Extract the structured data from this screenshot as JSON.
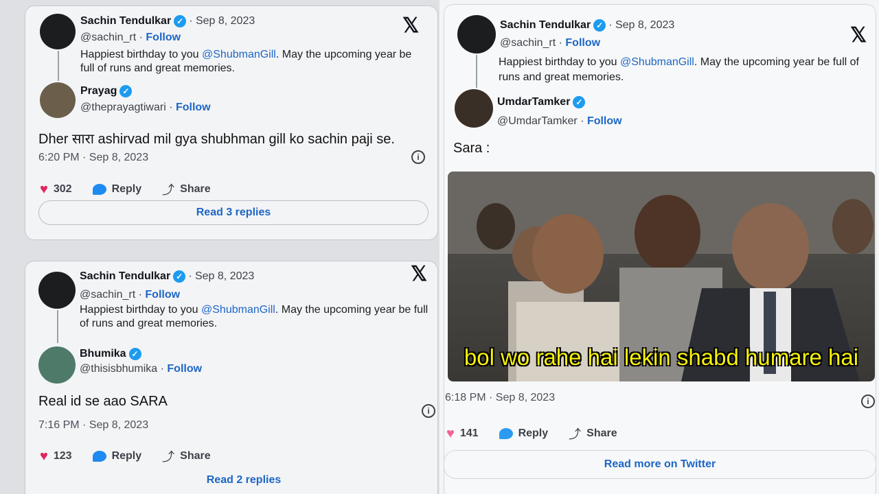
{
  "left": {
    "tweet1": {
      "parent": {
        "name": "Sachin Tendulkar",
        "date": "· Sep 8, 2023",
        "handle": "@sachin_rt ·",
        "follow": "Follow",
        "text_before": "Happiest birthday to you ",
        "mention": "@ShubmanGill",
        "text_after": ". May the upcoming year be full of runs and great memories."
      },
      "reply": {
        "name": "Prayag",
        "handle": "@theprayagtiwari ·",
        "follow": "Follow",
        "text": "Dher सारा ashirvad mil gya shubhman gill ko sachin paji se.",
        "timestamp": "6:20 PM · Sep 8, 2023",
        "likes": "302",
        "reply_label": "Reply",
        "share_label": "Share",
        "read_replies": "Read 3 replies"
      }
    },
    "tweet2": {
      "parent": {
        "name": "Sachin Tendulkar",
        "date": "· Sep 8, 2023",
        "handle": "@sachin_rt ·",
        "follow": "Follow",
        "text_before": "Happiest birthday to you ",
        "mention": "@ShubmanGill",
        "text_after": ". May the upcoming year be full of runs and great memories."
      },
      "reply": {
        "name": "Bhumika",
        "handle": "@thisisbhumika ·",
        "follow": "Follow",
        "text": "Real id se aao SARA",
        "timestamp": "7:16 PM · Sep 8, 2023",
        "likes": "123",
        "reply_label": "Reply",
        "share_label": "Share",
        "read_replies": "Read 2 replies"
      }
    }
  },
  "right": {
    "parent": {
      "name": "Sachin Tendulkar",
      "date": "· Sep 8, 2023",
      "handle": "@sachin_rt ·",
      "follow": "Follow",
      "text_before": "Happiest birthday to you ",
      "mention": "@ShubmanGill",
      "text_after": ". May the upcoming year be full of runs and great memories."
    },
    "reply": {
      "name": "UmdarTamker",
      "handle": "@UmdarTamker ·",
      "follow": "Follow",
      "text": "Sara :",
      "meme_caption": "bol wo rahe hai lekin shabd humare hai",
      "timestamp": "6:18 PM · Sep 8, 2023",
      "likes": "141",
      "reply_label": "Reply",
      "share_label": "Share",
      "read_more": "Read more on Twitter"
    }
  },
  "icons": {
    "x_logo": "𝕏",
    "verified": "✓",
    "heart": "♥",
    "share": "⤴",
    "info": "i"
  },
  "colors": {
    "accent": "#1d66c4",
    "verified": "#1d9bf0",
    "heart": "#e0245e",
    "meme_caption": "#f7f208"
  }
}
